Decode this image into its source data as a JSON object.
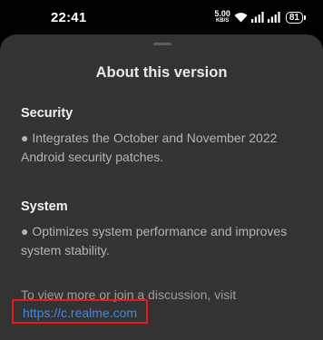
{
  "status_bar": {
    "time": "22:41",
    "net_speed_value": "5.00",
    "net_speed_unit": "KB/S",
    "battery": "81",
    "icons": [
      "wifi-icon",
      "signal-icon",
      "signal-icon",
      "battery-icon"
    ]
  },
  "sheet": {
    "title": "About this version",
    "sections": [
      {
        "heading": "Security",
        "body": "● Integrates the October and November 2022 Android security patches."
      },
      {
        "heading": "System",
        "body": "● Optimizes system performance and improves system stability."
      }
    ],
    "footer_text": "To view more or join a discussion, visit",
    "link": "https://c.realme.com"
  },
  "colors": {
    "sheet_background": "#333333",
    "link": "#3f8ae8",
    "highlight_box": "#e21b1b"
  }
}
